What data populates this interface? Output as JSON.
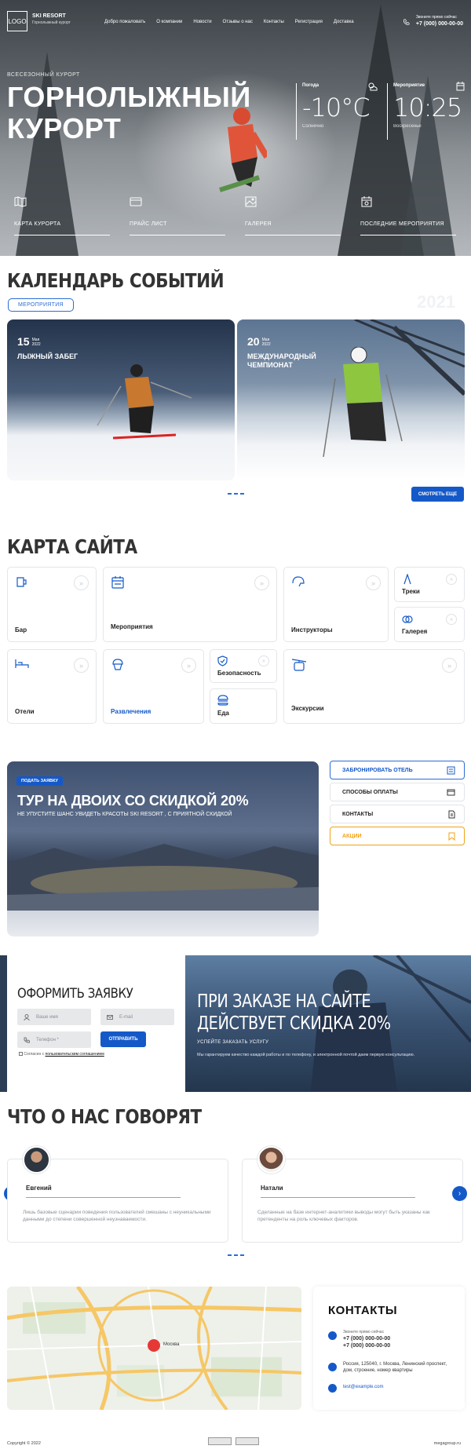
{
  "header": {
    "logo": "LOGO",
    "brand": "SKI RESORT",
    "brand_sub": "Горнолыжный курорт",
    "nav": [
      "Добро пожаловать",
      "О компании",
      "Новости",
      "Отзывы о нас",
      "Контакты",
      "Регистрация",
      "Доставка"
    ],
    "phone_caption": "Звоните прямо сейчас",
    "phone": "+7 (000) 000-00-00"
  },
  "hero": {
    "subtitle": "ВСЕСЕЗОННЫЙ КУРОРТ",
    "title": "ГОРНОЛЫЖНЫЙ КУРОРТ",
    "weather": {
      "label": "Погода",
      "value": "-10°С",
      "state": "Солнечно"
    },
    "event": {
      "label": "Мероприятие",
      "value": "10:25",
      "day": "Воскресенье"
    },
    "quick_links": [
      "КАРТА КУРОРТА",
      "ПРАЙС ЛИСТ",
      "ГАЛЕРЕЯ",
      "ПОСЛЕДНИЕ МЕРОПРИЯТИЯ"
    ]
  },
  "calendar": {
    "title": "КАЛЕНДАРЬ СОБЫТИЙ",
    "tag": "МЕРОПРИЯТИЯ",
    "ghost": "2021",
    "events": [
      {
        "day": "15",
        "month": "Мая",
        "year": "2022",
        "title": "ЛЫЖНЫЙ ЗАБЕГ"
      },
      {
        "day": "20",
        "month": "Мая",
        "year": "2022",
        "title": "МЕЖДУНАРОДНЫЙ ЧЕМПИОНАТ"
      }
    ],
    "more": "СМОТРЕТЬ ЕЩЕ"
  },
  "sitemap": {
    "title": "КАРТА САЙТА",
    "items": [
      "Бар",
      "Мероприятия",
      "Инструкторы",
      "Треки",
      "Галерея",
      "Отели",
      "Развлечения",
      "Безопасность",
      "Еда",
      "Экскурсии"
    ]
  },
  "promo": {
    "tag": "ПОДАТЬ ЗАЯВКУ",
    "title": "ТУР НА ДВОИХ СО СКИДКОЙ 20%",
    "subtitle": "НЕ УПУСТИТЕ ШАНС УВИДЕТЬ КРАСОТЫ SKI RESORT , С ПРИЯТНОЙ СКИДКОЙ",
    "side": [
      "ЗАБРОНИРОВАТЬ ОТЕЛЬ",
      "СПОСОБЫ ОПЛАТЫ",
      "КОНТАКТЫ",
      "АКЦИИ"
    ]
  },
  "form": {
    "title": "ОФОРМИТЬ ЗАЯВКУ",
    "name_ph": "Ваше имя",
    "email_ph": "E-mail",
    "phone_ph": "Телефон *",
    "submit": "ОТПРАВИТЬ",
    "agree": "Согласен с",
    "agree_link": "пользовательским соглашением"
  },
  "discount": {
    "title": "ПРИ ЗАКАЗЕ НА САЙТЕ ДЕЙСТВУЕТ СКИДКА 20%",
    "subtitle": "УСПЕЙТЕ ЗАКАЗАТЬ УСЛУГУ",
    "text": "Мы гарантируем качество каждой работы и по телефону, и электронной почтой даем первую консультацию."
  },
  "reviews": {
    "title": "ЧТО О НАС ГОВОРЯТ",
    "items": [
      {
        "name": "Евгений",
        "text": "Лишь базовые сценарии поведения пользователей смешаны с неуникальными данными до степени совершенной неузнаваемости."
      },
      {
        "name": "Натали",
        "text": "Сделанные на базе интернет-аналитики выводы могут быть указаны как претенденты на роль ключевых факторов."
      }
    ]
  },
  "contacts": {
    "title": "КОНТАКТЫ",
    "caption": "Звоните прямо сейчас",
    "phones": [
      "+7 (000) 000-00-00",
      "+7 (000) 000-00-00"
    ],
    "address": "Россия, 125040, г. Москва, Ленинский проспект, дом, строение, номер квартиры",
    "email": "test@example.com",
    "map_city": "Москва"
  },
  "footer": {
    "copyright": "Copyright © 2022",
    "dev": "megagroup.ru"
  },
  "colors": {
    "accent": "#1559c8",
    "promo_orange": "#f0a21a"
  }
}
